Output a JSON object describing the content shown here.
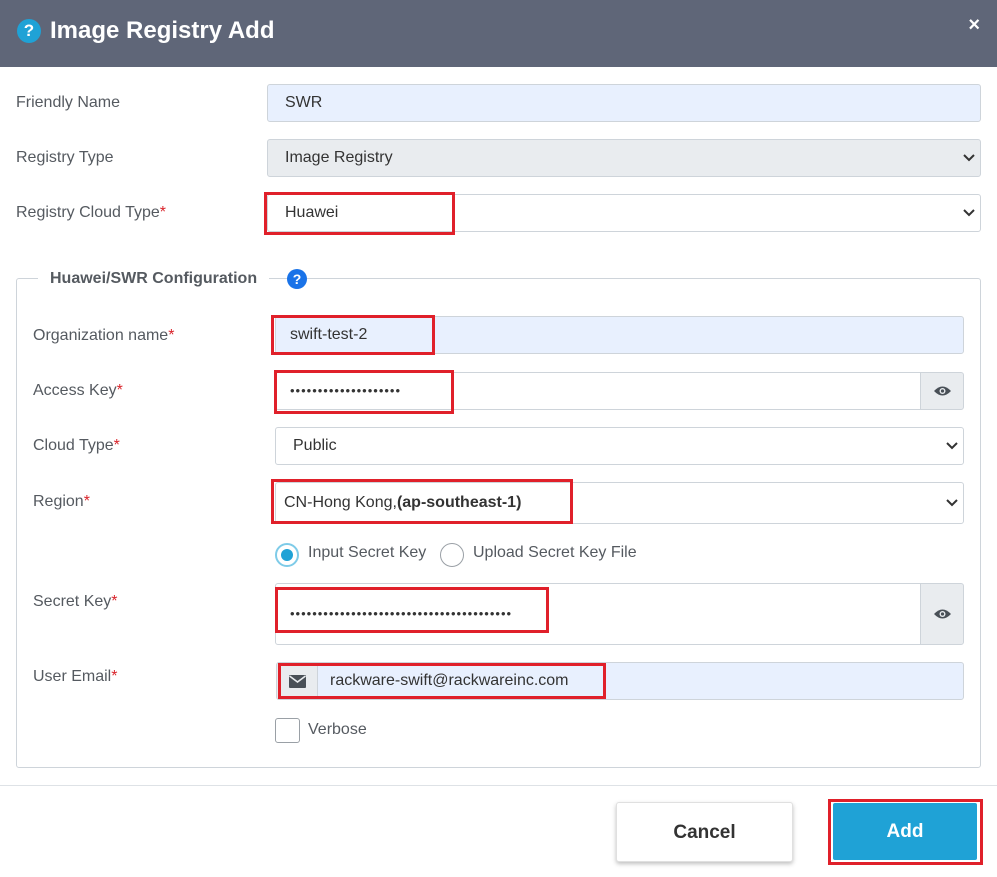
{
  "dialog": {
    "title": "Image Registry Add",
    "close_symbol": "×",
    "help_symbol": "?"
  },
  "general": {
    "friendly_name": {
      "label": "Friendly Name",
      "value": "SWR"
    },
    "registry_type": {
      "label": "Registry Type",
      "value": "Image Registry"
    },
    "registry_cloud_type": {
      "label": "Registry Cloud Type",
      "required": "*",
      "value": "Huawei"
    }
  },
  "config": {
    "legend": "Huawei/SWR Configuration",
    "help_symbol": "?",
    "organization_name": {
      "label": "Organization name",
      "required": "*",
      "value": "swift-test-2"
    },
    "access_key": {
      "label": "Access Key",
      "required": "*",
      "value": "••••••••••••••••••••"
    },
    "cloud_type": {
      "label": "Cloud Type",
      "required": "*",
      "value": "Public"
    },
    "region": {
      "label": "Region",
      "required": "*",
      "value_plain": "CN-Hong Kong,",
      "value_bold": "(ap-southeast-1)"
    },
    "secret_mode": {
      "option_input": "Input Secret Key",
      "option_upload": "Upload Secret Key File",
      "selected": "Input Secret Key"
    },
    "secret_key": {
      "label": "Secret Key",
      "required": "*",
      "value": "••••••••••••••••••••••••••••••••••••••••"
    },
    "user_email": {
      "label": "User Email",
      "required": "*",
      "value": "rackware-swift@rackwareinc.com"
    },
    "verbose": {
      "label": "Verbose",
      "checked": false
    }
  },
  "footer": {
    "cancel_label": "Cancel",
    "add_label": "Add"
  },
  "colors": {
    "header_bg": "#5f6678",
    "accent": "#1fa2d6",
    "highlight": "#e0202a",
    "required": "#d9232a"
  }
}
